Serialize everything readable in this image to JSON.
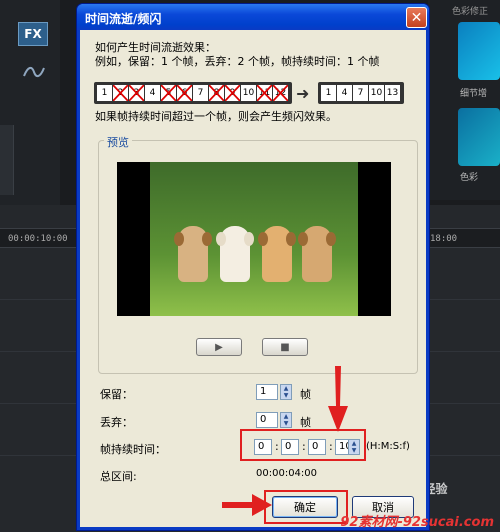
{
  "background": {
    "fx_label": "FX",
    "ruler_left": "00:00:10:00",
    "ruler_right": "18:00",
    "right_panel_label": "色彩修正",
    "thumb_caption_1": "细节增",
    "thumb_caption_2": "色彩",
    "baidu_label": "Bai 经验",
    "watermark": "92素材网-92sucai.com"
  },
  "dialog": {
    "title": "时间流逝/频闪",
    "close_label": "✕",
    "desc_line1": "如何产生时间流逝效果：",
    "desc_line2": "例如，保留：1 个帧，丢弃：2 个帧，帧持续时间：1 个帧",
    "before_frames": [
      "1",
      "2",
      "3",
      "4",
      "5",
      "6",
      "7",
      "8",
      "9",
      "10",
      "11",
      "12"
    ],
    "dropped_frames": [
      "2",
      "3",
      "5",
      "6",
      "8",
      "9",
      "11",
      "12"
    ],
    "after_frames": [
      "1",
      "4",
      "7",
      "10",
      "13"
    ],
    "note": "如果帧持续时间超过一个帧，则会产生频闪效果。",
    "preview_label": "预览",
    "play_icon": "play-icon",
    "stop_icon": "stop-icon",
    "keep_label": "保留：",
    "keep_value": "1",
    "keep_unit": "帧",
    "drop_label": "丢弃：",
    "drop_value": "0",
    "drop_unit": "帧",
    "duration_label": "帧持续时间：",
    "duration_hours": "0",
    "duration_minutes": "0",
    "duration_seconds": "0",
    "duration_frames": "10",
    "duration_format": "(H:M:S:f)",
    "total_label": "总区间:",
    "total_value": "00:00:04:00",
    "ok_label": "确定",
    "cancel_label": "取消"
  }
}
